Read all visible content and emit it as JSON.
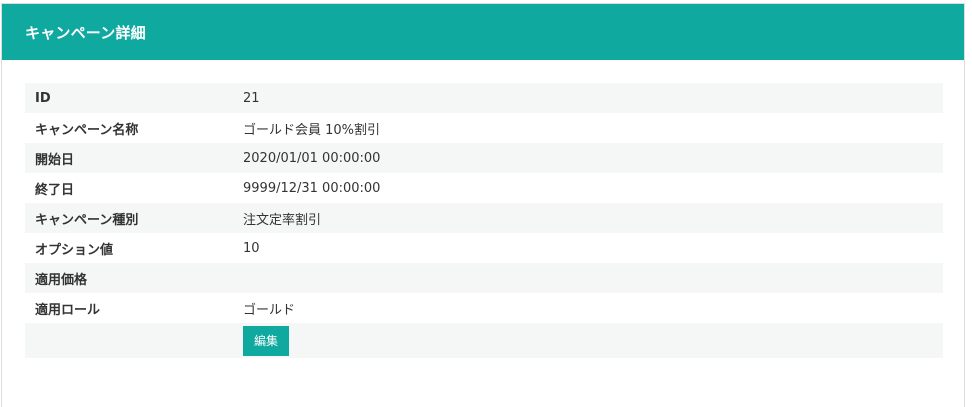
{
  "header": {
    "title": "キャンペーン詳細"
  },
  "details": [
    {
      "label": "ID",
      "value": "21"
    },
    {
      "label": "キャンペーン名称",
      "value": "ゴールド会員 10%割引"
    },
    {
      "label": "開始日",
      "value": "2020/01/01 00:00:00"
    },
    {
      "label": "終了日",
      "value": "9999/12/31 00:00:00"
    },
    {
      "label": "キャンペーン種別",
      "value": "注文定率割引"
    },
    {
      "label": "オプション値",
      "value": "10"
    },
    {
      "label": "適用価格",
      "value": ""
    },
    {
      "label": "適用ロール",
      "value": "ゴールド"
    }
  ],
  "actions": {
    "edit_label": "編集"
  },
  "colors": {
    "accent": "#0fa9a0",
    "row_stripe": "#f5f7f7"
  }
}
